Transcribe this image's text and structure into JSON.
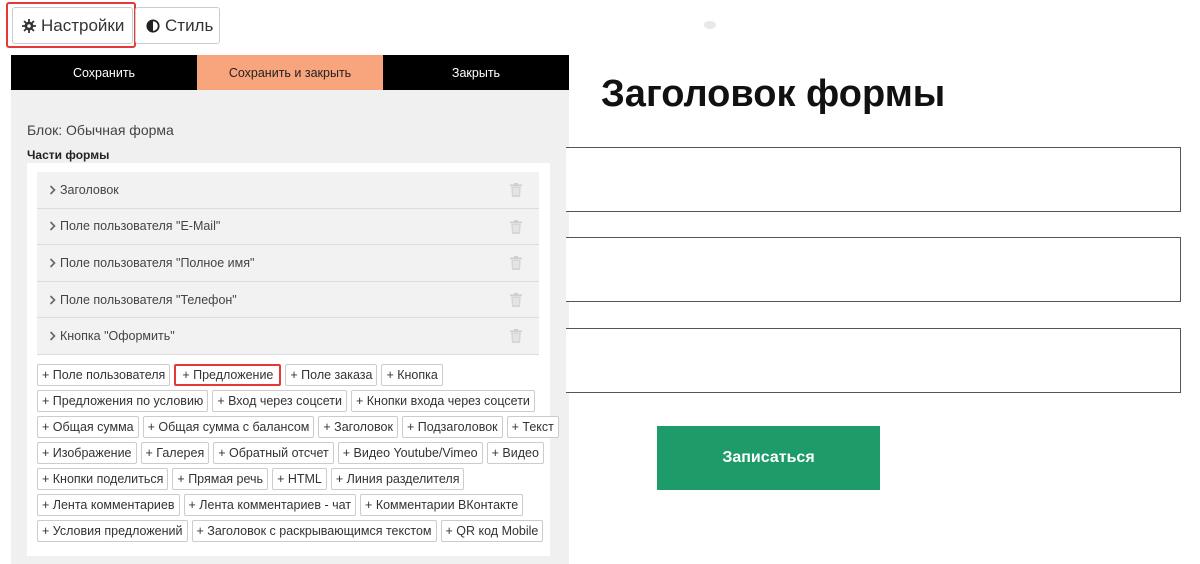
{
  "tabs": {
    "settings": "Настройки",
    "style": "Стиль"
  },
  "actions": {
    "save": "Сохранить",
    "save_close": "Сохранить и закрыть",
    "close": "Закрыть"
  },
  "panel": {
    "block_title": "Блок: Обычная форма",
    "parts_title": "Части формы",
    "parts": [
      "Заголовок",
      "Поле пользователя \"E-Mail\"",
      "Поле пользователя \"Полное имя\"",
      "Поле пользователя \"Телефон\"",
      "Кнопка \"Оформить\""
    ]
  },
  "chips": [
    [
      "+ Поле пользователя",
      "+ Предложение",
      "+ Поле заказа",
      "+ Кнопка"
    ],
    [
      "+ Предложения по условию",
      "+ Вход через соцсети",
      "+ Кнопки входа через соцсети"
    ],
    [
      "+ Общая сумма",
      "+ Общая сумма с балансом",
      "+ Заголовок",
      "+ Подзаголовок",
      "+ Текст"
    ],
    [
      "+ Изображение",
      "+ Галерея",
      "+ Обратный отсчет",
      "+ Видео Youtube/Vimeo",
      "+ Видео"
    ],
    [
      "+ Кнопки поделиться",
      "+ Прямая речь",
      "+ HTML",
      "+ Линия разделителя"
    ],
    [
      "+ Лента комментариев",
      "+ Лента комментариев - чат",
      "+ Комментарии ВКонтакте"
    ],
    [
      "+ Условия предложений",
      "+ Заголовок с раскрывающимся текстом",
      "+ QR код Mobile"
    ]
  ],
  "highlighted_chip": "+ Предложение",
  "icons": {
    "settings": "gear-icon",
    "style": "contrast-icon",
    "part_expand": "chevron-right-icon",
    "part_delete": "trash-icon"
  },
  "colors": {
    "save_close_bg": "#f8a57d",
    "action_bg": "#000000",
    "submit_bg": "#1d9c6a",
    "highlight": "#e53935"
  },
  "form": {
    "title": "Заголовок формы",
    "submit_label": "Записаться"
  }
}
